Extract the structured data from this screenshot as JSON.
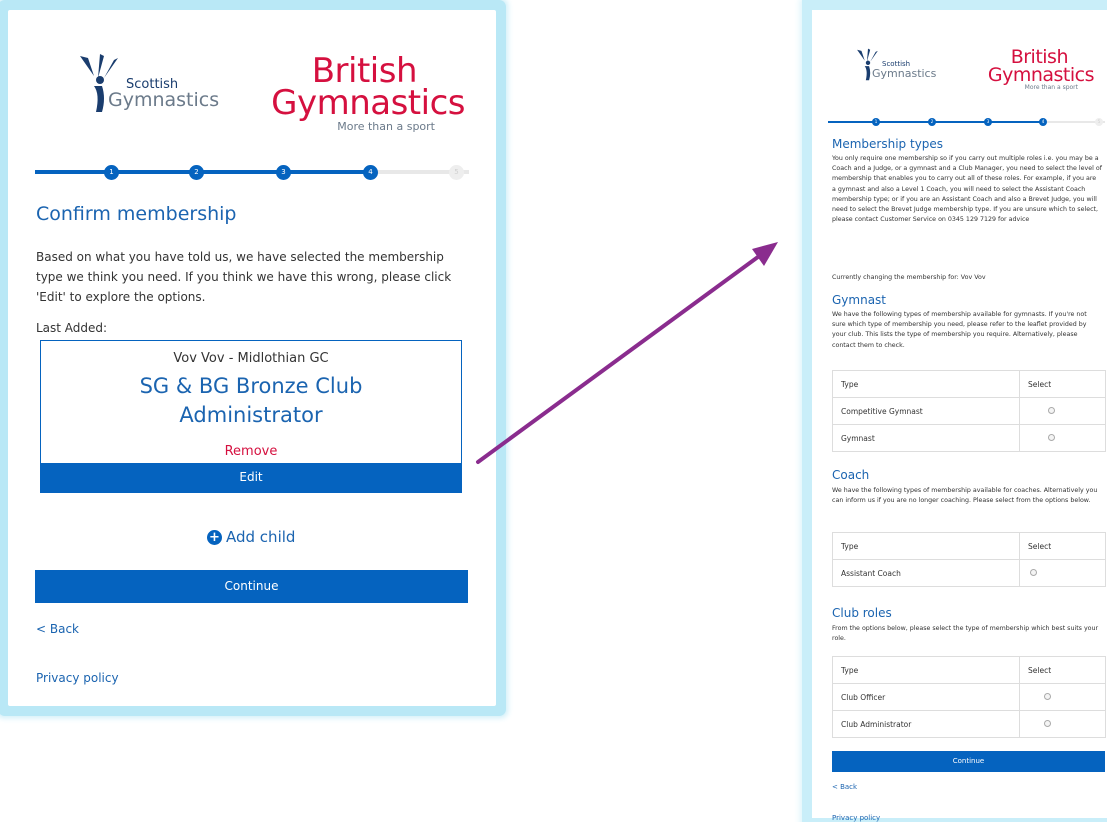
{
  "colors": {
    "brand_blue": "#0563bf",
    "brand_red": "#d5103f",
    "arrow": "#8a2c8e",
    "frame_glow": "#b9e8f6"
  },
  "logos": {
    "scottish_top": "Scottish",
    "scottish_bottom": "Gymnastics",
    "british_line1": "British",
    "british_line2": "Gymnastics",
    "british_tagline": "More than a sport"
  },
  "left": {
    "progress": {
      "steps": [
        "1",
        "2",
        "3",
        "4",
        "5"
      ],
      "current_step": 4,
      "total_steps": 5
    },
    "title": "Confirm membership",
    "intro": "Based on what you have told us, we have selected the membership type we think you need. If you think we have this wrong, please click 'Edit' to explore the options.",
    "last_added_label": "Last Added:",
    "card": {
      "member": "Vov Vov - Midlothian GC",
      "membership_type": "SG & BG Bronze Club Administrator",
      "remove_label": "Remove",
      "edit_label": "Edit"
    },
    "add_child_label": "Add child",
    "continue_label": "Continue",
    "back_label": "< Back",
    "privacy_label": "Privacy policy"
  },
  "right": {
    "progress": {
      "steps": [
        "1",
        "2",
        "3",
        "4",
        "5"
      ],
      "current_step": 4,
      "total_steps": 5
    },
    "title": "Membership types",
    "intro": "You only require one membership so if you carry out multiple roles i.e. you may be a Coach and a Judge, or a gymnast and a Club Manager, you need to select the level of membership that enables you to carry out all of these roles. For example, if you are a gymnast and also a Level 1 Coach, you will need to select the Assistant Coach membership type; or if you are an Assistant Coach and also a Brevet Judge, you will need to select the Brevet Judge membership type. If you are unsure which to select, please contact Customer Service on 0345 129 7129 for advice",
    "changing_for": "Currently changing the membership for: Vov Vov",
    "sections": [
      {
        "title": "Gymnast",
        "description": "We have the following types of membership available for gymnasts. If you're not sure which type of membership you need, please refer to the leaflet provided by your club. This lists the type of membership you require. Alternatively, please contact them to check.",
        "headers": {
          "type": "Type",
          "select": "Select"
        },
        "rows": [
          {
            "type": "Competitive Gymnast"
          },
          {
            "type": "Gymnast"
          }
        ]
      },
      {
        "title": "Coach",
        "description": "We have the following types of membership available for coaches. Alternatively you can inform us if you are no longer coaching. Please select from the options below.",
        "headers": {
          "type": "Type",
          "select": "Select"
        },
        "rows": [
          {
            "type": "Assistant Coach"
          }
        ]
      },
      {
        "title": "Club roles",
        "description": "From the options below, please select the type of membership which best suits your role.",
        "headers": {
          "type": "Type",
          "select": "Select"
        },
        "rows": [
          {
            "type": "Club Officer"
          },
          {
            "type": "Club Administrator"
          }
        ]
      }
    ],
    "continue_label": "Continue",
    "back_label": "< Back",
    "privacy_label": "Privacy policy"
  }
}
